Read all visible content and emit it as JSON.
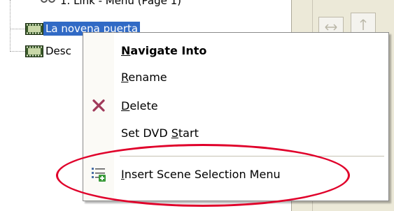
{
  "tree": {
    "top_partial_text": "1. Link - Menu (Page 1)",
    "items": [
      {
        "label": "La novena puerta",
        "selected": true
      },
      {
        "label": "Desc",
        "selected": false
      }
    ]
  },
  "context_menu": {
    "items": [
      {
        "before": "",
        "mnemonic": "N",
        "after": "avigate Into",
        "bold": true,
        "icon": ""
      },
      {
        "before": "",
        "mnemonic": "R",
        "after": "ename",
        "bold": false,
        "icon": ""
      },
      {
        "before": "",
        "mnemonic": "D",
        "after": "elete",
        "bold": false,
        "icon": "delete-x-icon"
      },
      {
        "before": "Set DVD ",
        "mnemonic": "S",
        "after": "tart",
        "bold": false,
        "icon": ""
      },
      {
        "before": "",
        "mnemonic": "I",
        "after": "nsert Scene Selection Menu",
        "bold": false,
        "icon": "insert-scene-menu-icon"
      }
    ]
  },
  "colors": {
    "selection": "#316ac5",
    "delete_x": "#a0395a",
    "annotation_ring": "#e0002a",
    "panel": "#ece9d8"
  }
}
